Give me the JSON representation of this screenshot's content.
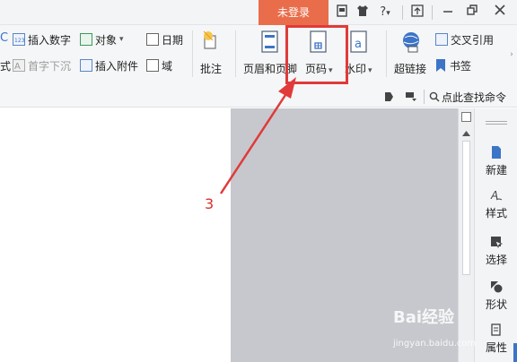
{
  "titlebar": {
    "login_label": "未登录",
    "help_label": "?",
    "icons": [
      "skin-icon",
      "tshirt-icon",
      "help-icon",
      "share-icon",
      "minimize-icon",
      "restore-icon",
      "close-icon"
    ]
  },
  "ribbon": {
    "partial_left_label": "式",
    "insert_number": "插入数字",
    "first_drop_cap": "首字下沉",
    "object": "对象",
    "insert_attachment": "插入附件",
    "date": "日期",
    "field": "域",
    "comment": "批注",
    "header_footer": "页眉和页脚",
    "page_number": "页码",
    "watermark": "水印",
    "hyperlink": "超链接",
    "cross_reference": "交叉引用",
    "bookmark": "书签",
    "dropdown_glyph": "▾"
  },
  "search": {
    "label": "点此查找命令"
  },
  "sidepanel": {
    "items": [
      {
        "label": "新建"
      },
      {
        "label": "样式"
      },
      {
        "label": "选择"
      },
      {
        "label": "形状"
      },
      {
        "label": "属性"
      }
    ]
  },
  "annotation": {
    "step": "3",
    "color": "#e03a3a"
  },
  "watermark_text": {
    "main": "Bai经验",
    "sub": "jingyan.baidu.com"
  },
  "colors": {
    "login_bg": "#ea6d4b",
    "accent_blue": "#3c74c8"
  }
}
